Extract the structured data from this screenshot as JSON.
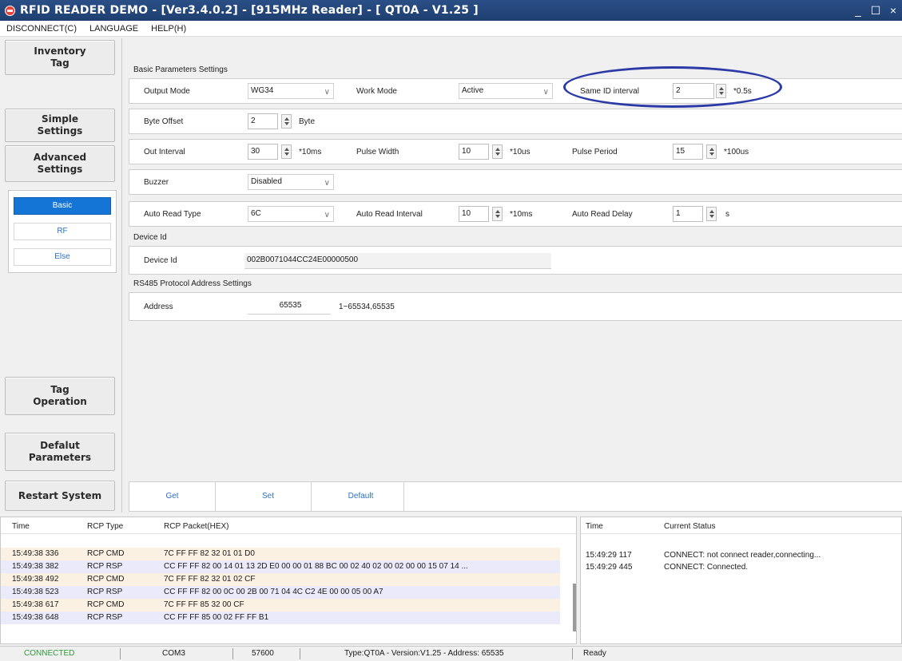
{
  "window": {
    "title": "RFID READER DEMO - [Ver3.4.0.2] - [915MHz Reader] - [ QT0A - V1.25 ]",
    "controls": [
      "_",
      "☐",
      "×"
    ]
  },
  "menu": [
    "DISCONNECT(C)",
    "LANGUAGE",
    "HELP(H)"
  ],
  "nav": {
    "inventory": "Inventory Tag",
    "simple": "Simple Settings",
    "advanced": "Advanced Settings",
    "sub": [
      "Basic",
      "RF",
      "Else"
    ],
    "tag_operation": "Tag Operation",
    "defaults": "Defalut Parameters",
    "restart": "Restart System"
  },
  "basic": {
    "section": "Basic Parameters Settings",
    "output_mode_label": "Output Mode",
    "output_mode": "WG34",
    "work_mode_label": "Work Mode",
    "work_mode": "Active",
    "same_id_label": "Same ID interval",
    "same_id_value": "2",
    "same_id_unit": "*0.5s",
    "byte_offset_label": "Byte Offset",
    "byte_offset_value": "2",
    "byte_offset_unit": "Byte",
    "out_interval_label": "Out Interval",
    "out_interval_value": "30",
    "out_interval_unit": "*10ms",
    "pulse_width_label": "Pulse Width",
    "pulse_width_value": "10",
    "pulse_width_unit": "*10us",
    "pulse_period_label": "Pulse Period",
    "pulse_period_value": "15",
    "pulse_period_unit": "*100us",
    "buzzer_label": "Buzzer",
    "buzzer_value": "Disabled",
    "auto_read_type_label": "Auto Read Type",
    "auto_read_type": "6C",
    "auto_read_interval_label": "Auto Read Interval",
    "auto_read_interval_value": "10",
    "auto_read_interval_unit": "*10ms",
    "auto_read_delay_label": "Auto Read Delay",
    "auto_read_delay_value": "1",
    "auto_read_delay_unit": "s"
  },
  "device": {
    "section": "Device Id",
    "label": "Device Id",
    "value": "002B0071044CC24E00000500"
  },
  "rs485": {
    "section": "RS485 Protocol Address Settings",
    "label": "Address",
    "value": "65535",
    "range": "1~65534,65535"
  },
  "actions": [
    "Get",
    "Set",
    "Default"
  ],
  "log": {
    "headers": [
      "Time",
      "RCP Type",
      "RCP Packet(HEX)"
    ],
    "rows": [
      {
        "time": "15:49:38 336",
        "type": "RCP CMD",
        "packet": "7C FF FF 82 32 01 01 D0"
      },
      {
        "time": "15:49:38 382",
        "type": "RCP RSP",
        "packet": "CC FF FF 82 00 14 01 13 2D E0 00 00 01 88 BC 00 02 40 02 00 02 00 00 15 07 14 ..."
      },
      {
        "time": "15:49:38 492",
        "type": "RCP CMD",
        "packet": "7C FF FF 82 32 01 02 CF"
      },
      {
        "time": "15:49:38 523",
        "type": "RCP RSP",
        "packet": "CC FF FF 82 00 0C 00 2B 00 71 04 4C C2 4E 00 00 05 00 A7"
      },
      {
        "time": "15:49:38 617",
        "type": "RCP CMD",
        "packet": "7C FF FF 85 32 00 CF"
      },
      {
        "time": "15:49:38 648",
        "type": "RCP RSP",
        "packet": "CC FF FF 85 00 02 FF FF B1"
      }
    ]
  },
  "status_log": {
    "headers": [
      "Time",
      "Current Status"
    ],
    "rows": [
      {
        "time": "15:49:29 117",
        "status": "CONNECT: not connect reader,connecting..."
      },
      {
        "time": "15:49:29 445",
        "status": "CONNECT: Connected."
      }
    ]
  },
  "statusbar": {
    "connection": "CONNECTED",
    "port": "COM3",
    "baud": "57600",
    "info": "Type:QT0A - Version:V1.25 - Address: 65535",
    "ready": "Ready",
    "connection_color": "#2e9a3a"
  }
}
